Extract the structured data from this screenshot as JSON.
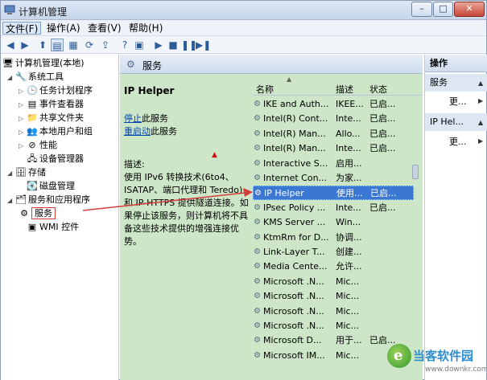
{
  "window": {
    "title": "计算机管理",
    "minimize": "–",
    "maximize": "□",
    "close": "✕"
  },
  "menu": [
    "文件(F)",
    "操作(A)",
    "查看(V)",
    "帮助(H)"
  ],
  "toolbar": [
    "back-icon",
    "forward-icon",
    "up-folder-icon",
    "console-tree-icon",
    "properties-icon",
    "refresh-icon",
    "export-icon",
    "help-icon",
    "view-icon",
    "play-icon",
    "stop-icon",
    "pause-icon",
    "restart-icon"
  ],
  "tree": {
    "root": "计算机管理(本地)",
    "system_tools": "系统工具",
    "task_scheduler": "任务计划程序",
    "event_viewer": "事件查看器",
    "shared_folders": "共享文件夹",
    "local_users": "本地用户和组",
    "performance": "性能",
    "device_manager": "设备管理器",
    "storage": "存储",
    "disk_management": "磁盘管理",
    "services_apps": "服务和应用程序",
    "services": "服务",
    "wmi": "WMI 控件"
  },
  "center": {
    "header": "服务",
    "service_name": "IP Helper",
    "stop_link": "停止",
    "stop_text": "此服务",
    "restart_link": "重启动",
    "restart_text": "此服务",
    "desc_label": "描述:",
    "description": "使用 IPv6 转换技术(6to4、ISATAP、端口代理和 Teredo)和 IP-HTTPS 提供隧道连接。如果停止该服务，则计算机将不具备这些技术提供的增强连接优势。"
  },
  "list": {
    "columns": [
      "名称",
      "描述",
      "状态"
    ],
    "rows": [
      [
        "IKE and Auth...",
        "IKEE...",
        "已启..."
      ],
      [
        "Intel(R) Cont...",
        "Inte...",
        "已启..."
      ],
      [
        "Intel(R) Man...",
        "Allo...",
        "已启..."
      ],
      [
        "Intel(R) Man...",
        "Inte...",
        "已启..."
      ],
      [
        "Interactive S...",
        "启用...",
        ""
      ],
      [
        "Internet Con...",
        "为家...",
        ""
      ],
      [
        "IP Helper",
        "使用...",
        "已启..."
      ],
      [
        "IPsec Policy ...",
        "Inte...",
        "已启..."
      ],
      [
        "KMS Server ...",
        "Win...",
        ""
      ],
      [
        "KtmRm for D...",
        "协调...",
        ""
      ],
      [
        "Link-Layer T...",
        "创建...",
        ""
      ],
      [
        "Media Cente...",
        "允许...",
        ""
      ],
      [
        "Microsoft .N...",
        "Mic...",
        ""
      ],
      [
        "Microsoft .N...",
        "Mic...",
        ""
      ],
      [
        "Microsoft .N...",
        "Mic...",
        ""
      ],
      [
        "Microsoft .N...",
        "Mic...",
        ""
      ],
      [
        "Microsoft D...",
        "用于...",
        "已启..."
      ],
      [
        "Microsoft IM...",
        "Mic...",
        ""
      ]
    ],
    "selected_index": 6
  },
  "actions": {
    "header": "操作",
    "group1": "服务",
    "more1": "更...",
    "group2": "IP Hel...",
    "more2": "更..."
  },
  "watermark": {
    "logo_letter": "e",
    "text": "当客软件园",
    "url": "www.downkr.com"
  },
  "colors": {
    "accent": "#3a78d4",
    "annotation": "#d63b3b",
    "detail_bg": "#cde6c7"
  }
}
